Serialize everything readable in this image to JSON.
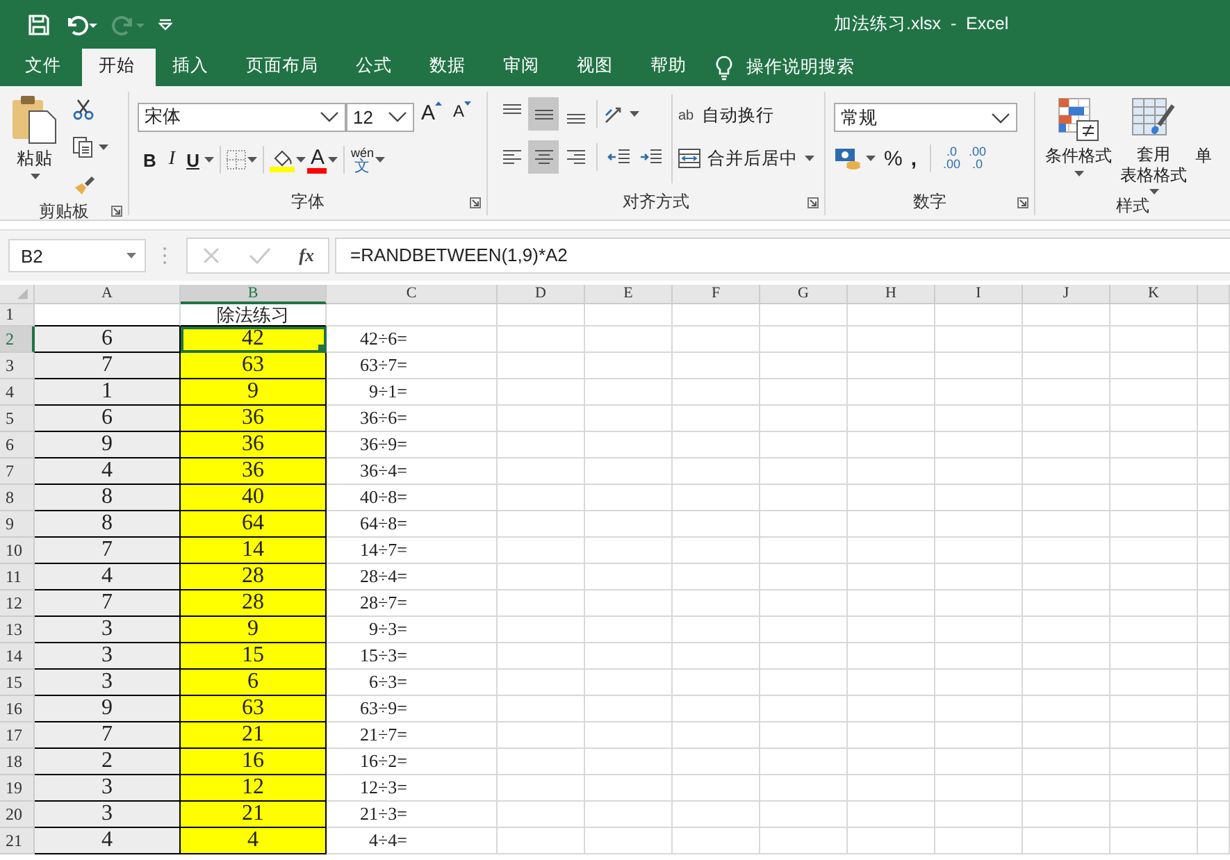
{
  "window": {
    "title": "加法练习.xlsx  -  Excel"
  },
  "quick_access": [
    {
      "kind": "save",
      "disabled": false
    },
    {
      "kind": "undo",
      "disabled": false
    },
    {
      "kind": "redo",
      "disabled": true
    },
    {
      "kind": "customize",
      "disabled": false
    }
  ],
  "tabs": [
    {
      "label": "文件",
      "selected": false
    },
    {
      "label": "开始",
      "selected": true
    },
    {
      "label": "插入",
      "selected": false
    },
    {
      "label": "页面布局",
      "selected": false
    },
    {
      "label": "公式",
      "selected": false
    },
    {
      "label": "数据",
      "selected": false
    },
    {
      "label": "审阅",
      "selected": false
    },
    {
      "label": "视图",
      "selected": false
    },
    {
      "label": "帮助",
      "selected": false
    }
  ],
  "tell_me": {
    "label": "操作说明搜索"
  },
  "ribbon": {
    "clipboard": {
      "label": "剪贴板",
      "paste": "粘贴"
    },
    "font": {
      "label": "字体",
      "font_name": "宋体",
      "font_size": "12",
      "grow": "A",
      "shrink": "A",
      "bold": "B",
      "italic": "I",
      "underline": "U",
      "font_color": "A",
      "phonetic_top": "wén",
      "phonetic_bottom": "文"
    },
    "alignment": {
      "label": "对齐方式",
      "vertical": [
        {
          "pressed": false
        },
        {
          "pressed": true
        },
        {
          "pressed": false
        }
      ],
      "horizontal": [
        {
          "pressed": false
        },
        {
          "pressed": true
        },
        {
          "pressed": false
        }
      ],
      "wrap_text": "自动换行",
      "wrap_icon": "ab",
      "merge": "合并后居中"
    },
    "number": {
      "label": "数字",
      "format": "常规",
      "percent": "%",
      "comma": ",",
      "increase_decimal": [
        ".0",
        ".00"
      ],
      "decrease_decimal": [
        ".00",
        ".0"
      ]
    },
    "styles": {
      "label": "样式",
      "conditional": "条件格式",
      "table_format": [
        "套用",
        "表格格式"
      ],
      "cell_styles": "单"
    }
  },
  "formula_bar": {
    "name_box": "B2",
    "function_label": "fx",
    "formula": "=RANDBETWEEN(1,9)*A2"
  },
  "sheet": {
    "columns": [
      {
        "label": "A",
        "selected": false
      },
      {
        "label": "B",
        "selected": true
      },
      {
        "label": "C",
        "selected": false
      },
      {
        "label": "D",
        "selected": false
      },
      {
        "label": "E",
        "selected": false
      },
      {
        "label": "F",
        "selected": false
      },
      {
        "label": "G",
        "selected": false
      },
      {
        "label": "H",
        "selected": false
      },
      {
        "label": "I",
        "selected": false
      },
      {
        "label": "J",
        "selected": false
      },
      {
        "label": "K",
        "selected": false
      }
    ],
    "rows": [
      {
        "number": "1",
        "selected": false,
        "cells": [
          {},
          {
            "text": "除法练习"
          },
          {}
        ]
      },
      {
        "number": "2",
        "selected": true,
        "cells": [
          {
            "text": "6",
            "color": "#ededed"
          },
          {
            "text": "42",
            "color": "#ffff00"
          },
          {
            "text": "42÷6="
          }
        ]
      },
      {
        "number": "3",
        "selected": false,
        "cells": [
          {
            "text": "7",
            "color": "#ededed"
          },
          {
            "text": "63",
            "color": "#ffff00"
          },
          {
            "text": "63÷7="
          }
        ]
      },
      {
        "number": "4",
        "selected": false,
        "cells": [
          {
            "text": "1",
            "color": "#ededed"
          },
          {
            "text": "9",
            "color": "#ffff00"
          },
          {
            "text": "9÷1="
          }
        ]
      },
      {
        "number": "5",
        "selected": false,
        "cells": [
          {
            "text": "6",
            "color": "#ededed"
          },
          {
            "text": "36",
            "color": "#ffff00"
          },
          {
            "text": "36÷6="
          }
        ]
      },
      {
        "number": "6",
        "selected": false,
        "cells": [
          {
            "text": "9",
            "color": "#ededed"
          },
          {
            "text": "36",
            "color": "#ffff00"
          },
          {
            "text": "36÷9="
          }
        ]
      },
      {
        "number": "7",
        "selected": false,
        "cells": [
          {
            "text": "4",
            "color": "#ededed"
          },
          {
            "text": "36",
            "color": "#ffff00"
          },
          {
            "text": "36÷4="
          }
        ]
      },
      {
        "number": "8",
        "selected": false,
        "cells": [
          {
            "text": "8",
            "color": "#ededed"
          },
          {
            "text": "40",
            "color": "#ffff00"
          },
          {
            "text": "40÷8="
          }
        ]
      },
      {
        "number": "9",
        "selected": false,
        "cells": [
          {
            "text": "8",
            "color": "#ededed"
          },
          {
            "text": "64",
            "color": "#ffff00"
          },
          {
            "text": "64÷8="
          }
        ]
      },
      {
        "number": "10",
        "selected": false,
        "cells": [
          {
            "text": "7",
            "color": "#ededed"
          },
          {
            "text": "14",
            "color": "#ffff00"
          },
          {
            "text": "14÷7="
          }
        ]
      },
      {
        "number": "11",
        "selected": false,
        "cells": [
          {
            "text": "4",
            "color": "#ededed"
          },
          {
            "text": "28",
            "color": "#ffff00"
          },
          {
            "text": "28÷4="
          }
        ]
      },
      {
        "number": "12",
        "selected": false,
        "cells": [
          {
            "text": "7",
            "color": "#ededed"
          },
          {
            "text": "28",
            "color": "#ffff00"
          },
          {
            "text": "28÷7="
          }
        ]
      },
      {
        "number": "13",
        "selected": false,
        "cells": [
          {
            "text": "3",
            "color": "#ededed"
          },
          {
            "text": "9",
            "color": "#ffff00"
          },
          {
            "text": "9÷3="
          }
        ]
      },
      {
        "number": "14",
        "selected": false,
        "cells": [
          {
            "text": "3",
            "color": "#ededed"
          },
          {
            "text": "15",
            "color": "#ffff00"
          },
          {
            "text": "15÷3="
          }
        ]
      },
      {
        "number": "15",
        "selected": false,
        "cells": [
          {
            "text": "3",
            "color": "#ededed"
          },
          {
            "text": "6",
            "color": "#ffff00"
          },
          {
            "text": "6÷3="
          }
        ]
      },
      {
        "number": "16",
        "selected": false,
        "cells": [
          {
            "text": "9",
            "color": "#ededed"
          },
          {
            "text": "63",
            "color": "#ffff00"
          },
          {
            "text": "63÷9="
          }
        ]
      },
      {
        "number": "17",
        "selected": false,
        "cells": [
          {
            "text": "7",
            "color": "#ededed"
          },
          {
            "text": "21",
            "color": "#ffff00"
          },
          {
            "text": "21÷7="
          }
        ]
      },
      {
        "number": "18",
        "selected": false,
        "cells": [
          {
            "text": "2",
            "color": "#ededed"
          },
          {
            "text": "16",
            "color": "#ffff00"
          },
          {
            "text": "16÷2="
          }
        ]
      },
      {
        "number": "19",
        "selected": false,
        "cells": [
          {
            "text": "3",
            "color": "#ededed"
          },
          {
            "text": "12",
            "color": "#ffff00"
          },
          {
            "text": "12÷3="
          }
        ]
      },
      {
        "number": "20",
        "selected": false,
        "cells": [
          {
            "text": "3",
            "color": "#ededed"
          },
          {
            "text": "21",
            "color": "#ffff00"
          },
          {
            "text": "21÷3="
          }
        ]
      },
      {
        "number": "21",
        "selected": false,
        "cells": [
          {
            "text": "4",
            "color": "#ededed"
          },
          {
            "text": "4",
            "color": "#ffff00"
          },
          {
            "text": "4÷4="
          }
        ]
      }
    ]
  }
}
